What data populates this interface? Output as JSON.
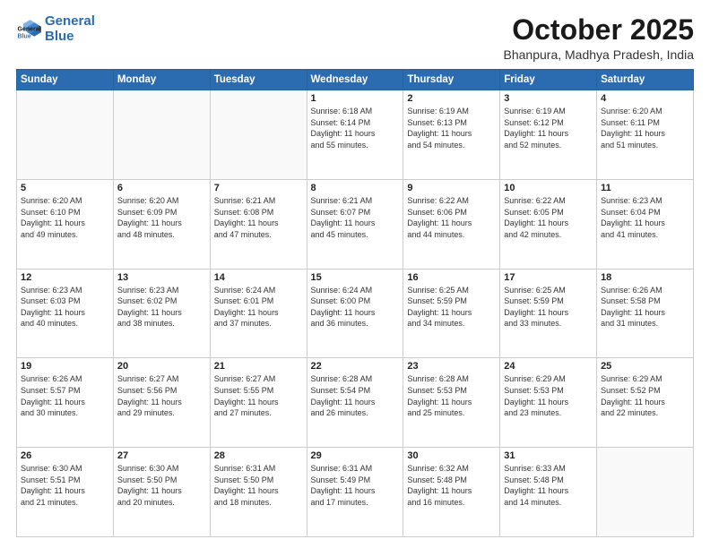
{
  "logo": {
    "line1": "General",
    "line2": "Blue"
  },
  "title": "October 2025",
  "subtitle": "Bhanpura, Madhya Pradesh, India",
  "headers": [
    "Sunday",
    "Monday",
    "Tuesday",
    "Wednesday",
    "Thursday",
    "Friday",
    "Saturday"
  ],
  "weeks": [
    [
      {
        "day": "",
        "info": ""
      },
      {
        "day": "",
        "info": ""
      },
      {
        "day": "",
        "info": ""
      },
      {
        "day": "1",
        "info": "Sunrise: 6:18 AM\nSunset: 6:14 PM\nDaylight: 11 hours\nand 55 minutes."
      },
      {
        "day": "2",
        "info": "Sunrise: 6:19 AM\nSunset: 6:13 PM\nDaylight: 11 hours\nand 54 minutes."
      },
      {
        "day": "3",
        "info": "Sunrise: 6:19 AM\nSunset: 6:12 PM\nDaylight: 11 hours\nand 52 minutes."
      },
      {
        "day": "4",
        "info": "Sunrise: 6:20 AM\nSunset: 6:11 PM\nDaylight: 11 hours\nand 51 minutes."
      }
    ],
    [
      {
        "day": "5",
        "info": "Sunrise: 6:20 AM\nSunset: 6:10 PM\nDaylight: 11 hours\nand 49 minutes."
      },
      {
        "day": "6",
        "info": "Sunrise: 6:20 AM\nSunset: 6:09 PM\nDaylight: 11 hours\nand 48 minutes."
      },
      {
        "day": "7",
        "info": "Sunrise: 6:21 AM\nSunset: 6:08 PM\nDaylight: 11 hours\nand 47 minutes."
      },
      {
        "day": "8",
        "info": "Sunrise: 6:21 AM\nSunset: 6:07 PM\nDaylight: 11 hours\nand 45 minutes."
      },
      {
        "day": "9",
        "info": "Sunrise: 6:22 AM\nSunset: 6:06 PM\nDaylight: 11 hours\nand 44 minutes."
      },
      {
        "day": "10",
        "info": "Sunrise: 6:22 AM\nSunset: 6:05 PM\nDaylight: 11 hours\nand 42 minutes."
      },
      {
        "day": "11",
        "info": "Sunrise: 6:23 AM\nSunset: 6:04 PM\nDaylight: 11 hours\nand 41 minutes."
      }
    ],
    [
      {
        "day": "12",
        "info": "Sunrise: 6:23 AM\nSunset: 6:03 PM\nDaylight: 11 hours\nand 40 minutes."
      },
      {
        "day": "13",
        "info": "Sunrise: 6:23 AM\nSunset: 6:02 PM\nDaylight: 11 hours\nand 38 minutes."
      },
      {
        "day": "14",
        "info": "Sunrise: 6:24 AM\nSunset: 6:01 PM\nDaylight: 11 hours\nand 37 minutes."
      },
      {
        "day": "15",
        "info": "Sunrise: 6:24 AM\nSunset: 6:00 PM\nDaylight: 11 hours\nand 36 minutes."
      },
      {
        "day": "16",
        "info": "Sunrise: 6:25 AM\nSunset: 5:59 PM\nDaylight: 11 hours\nand 34 minutes."
      },
      {
        "day": "17",
        "info": "Sunrise: 6:25 AM\nSunset: 5:59 PM\nDaylight: 11 hours\nand 33 minutes."
      },
      {
        "day": "18",
        "info": "Sunrise: 6:26 AM\nSunset: 5:58 PM\nDaylight: 11 hours\nand 31 minutes."
      }
    ],
    [
      {
        "day": "19",
        "info": "Sunrise: 6:26 AM\nSunset: 5:57 PM\nDaylight: 11 hours\nand 30 minutes."
      },
      {
        "day": "20",
        "info": "Sunrise: 6:27 AM\nSunset: 5:56 PM\nDaylight: 11 hours\nand 29 minutes."
      },
      {
        "day": "21",
        "info": "Sunrise: 6:27 AM\nSunset: 5:55 PM\nDaylight: 11 hours\nand 27 minutes."
      },
      {
        "day": "22",
        "info": "Sunrise: 6:28 AM\nSunset: 5:54 PM\nDaylight: 11 hours\nand 26 minutes."
      },
      {
        "day": "23",
        "info": "Sunrise: 6:28 AM\nSunset: 5:53 PM\nDaylight: 11 hours\nand 25 minutes."
      },
      {
        "day": "24",
        "info": "Sunrise: 6:29 AM\nSunset: 5:53 PM\nDaylight: 11 hours\nand 23 minutes."
      },
      {
        "day": "25",
        "info": "Sunrise: 6:29 AM\nSunset: 5:52 PM\nDaylight: 11 hours\nand 22 minutes."
      }
    ],
    [
      {
        "day": "26",
        "info": "Sunrise: 6:30 AM\nSunset: 5:51 PM\nDaylight: 11 hours\nand 21 minutes."
      },
      {
        "day": "27",
        "info": "Sunrise: 6:30 AM\nSunset: 5:50 PM\nDaylight: 11 hours\nand 20 minutes."
      },
      {
        "day": "28",
        "info": "Sunrise: 6:31 AM\nSunset: 5:50 PM\nDaylight: 11 hours\nand 18 minutes."
      },
      {
        "day": "29",
        "info": "Sunrise: 6:31 AM\nSunset: 5:49 PM\nDaylight: 11 hours\nand 17 minutes."
      },
      {
        "day": "30",
        "info": "Sunrise: 6:32 AM\nSunset: 5:48 PM\nDaylight: 11 hours\nand 16 minutes."
      },
      {
        "day": "31",
        "info": "Sunrise: 6:33 AM\nSunset: 5:48 PM\nDaylight: 11 hours\nand 14 minutes."
      },
      {
        "day": "",
        "info": ""
      }
    ]
  ]
}
